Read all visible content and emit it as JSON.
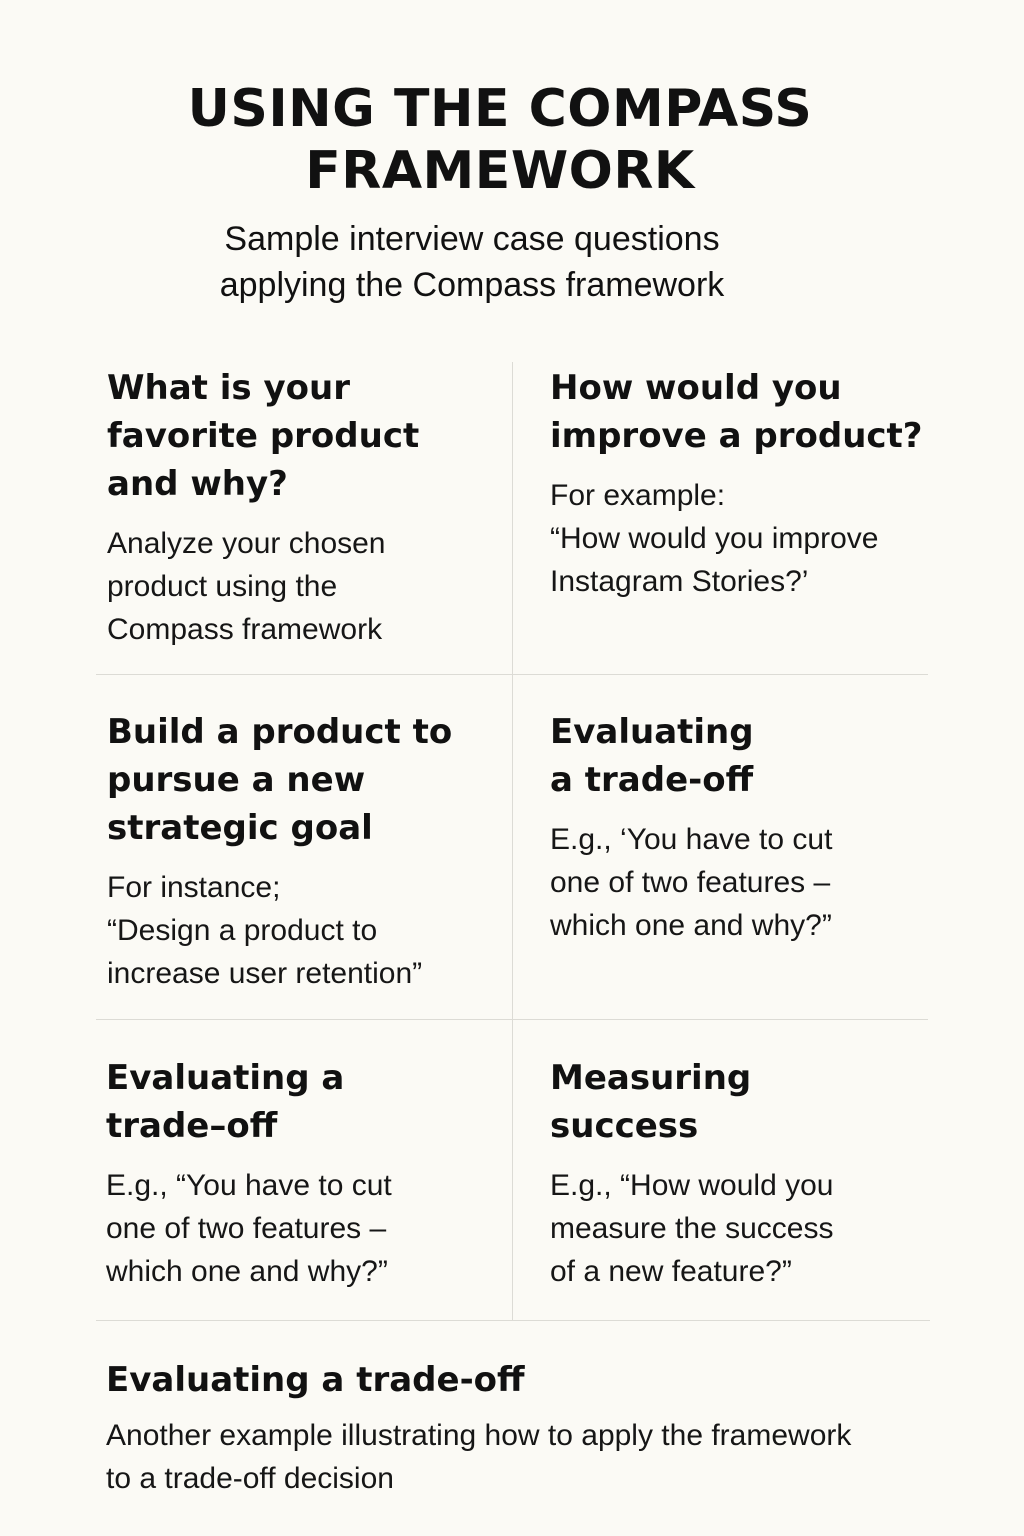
{
  "header": {
    "title_lines": [
      "USING THE COMPASS",
      "FRAMEWORK"
    ],
    "subtitle_lines": [
      "Sample interview case questions",
      "applying the Compass framework"
    ]
  },
  "cards": [
    {
      "title_lines": [
        "What is your",
        "favorite product",
        "and why?"
      ],
      "body_lines": [
        "Analyze your chosen",
        "product using the",
        "Compass framework"
      ]
    },
    {
      "title_lines": [
        "How would you",
        "improve a product?"
      ],
      "body_lines": [
        "For example:",
        "“How would you improve",
        "Instagram Stories?’"
      ]
    },
    {
      "title_lines": [
        "Build a product to",
        "pursue a new",
        "strategic goal"
      ],
      "body_lines": [
        "For instance;",
        "“Design a product to",
        "increase user retention”"
      ]
    },
    {
      "title_lines": [
        "Evaluating",
        "a trade-off"
      ],
      "body_lines": [
        "E.g., ‘You have to cut",
        "one of two features –",
        "which one and why?”"
      ]
    },
    {
      "title_lines": [
        "Evaluating a",
        "trade–off"
      ],
      "body_lines": [
        "E.g., “You have to cut",
        "one of two features –",
        "which one and why?”"
      ]
    },
    {
      "title_lines": [
        "Measuring",
        "success"
      ],
      "body_lines": [
        "E.g., “How would you",
        "measure the success",
        "of a new feature?”"
      ]
    }
  ],
  "footer": {
    "title": "Evaluating a trade-off",
    "body_lines": [
      "Another example illustrating how to apply the framework",
      "to a trade-off decision"
    ]
  }
}
